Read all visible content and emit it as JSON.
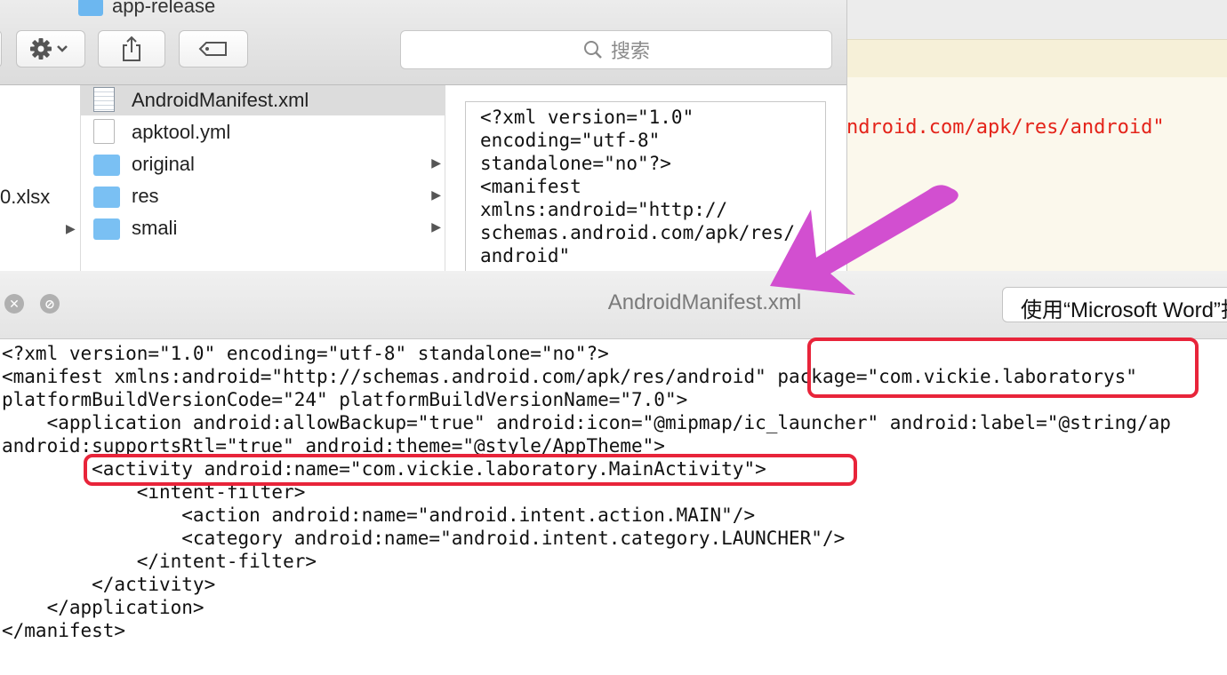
{
  "finder": {
    "path_title": "app-release",
    "toolbar": {
      "action_icon": "gear-icon",
      "share_icon": "share-icon",
      "tag_icon": "tag-icon",
      "search_placeholder": "搜索"
    },
    "left_column": {
      "partial_item": "0.xlsx"
    },
    "items": [
      {
        "label": "AndroidManifest.xml",
        "icon": "xml-file-icon",
        "selected": true
      },
      {
        "label": "apktool.yml",
        "icon": "file-icon"
      },
      {
        "label": "original",
        "icon": "folder-icon",
        "has_children": true
      },
      {
        "label": "res",
        "icon": "folder-icon",
        "has_children": true
      },
      {
        "label": "smali",
        "icon": "folder-icon",
        "has_children": true
      }
    ],
    "preview_lines": [
      "<?xml version=\"1.0\"",
      "encoding=\"utf-8\"",
      "standalone=\"no\"?>",
      "<manifest",
      "xmlns:android=\"http://",
      "schemas.android.com/apk/res/",
      "android\""
    ]
  },
  "background_editor": {
    "code_fragment": "ndroid.com/apk/res/android\""
  },
  "quicklook": {
    "title": "AndroidManifest.xml",
    "open_with_label": "使用“Microsoft Word”打开",
    "code_lines": [
      "<?xml version=\"1.0\" encoding=\"utf-8\" standalone=\"no\"?>",
      "<manifest xmlns:android=\"http://schemas.android.com/apk/res/android\" package=\"com.vickie.laboratorys\"",
      "platformBuildVersionCode=\"24\" platformBuildVersionName=\"7.0\">",
      "    <application android:allowBackup=\"true\" android:icon=\"@mipmap/ic_launcher\" android:label=\"@string/ap",
      "android:supportsRtl=\"true\" android:theme=\"@style/AppTheme\">",
      "        <activity android:name=\"com.vickie.laboratory.MainActivity\">",
      "            <intent-filter>",
      "                <action android:name=\"android.intent.action.MAIN\"/>",
      "                <category android:name=\"android.intent.category.LAUNCHER\"/>",
      "            </intent-filter>",
      "        </activity>",
      "    </application>",
      "</manifest>"
    ]
  },
  "colors": {
    "highlight": "#e8243a",
    "arrow": "#d24fd0",
    "editor_code": "#e4241a"
  }
}
